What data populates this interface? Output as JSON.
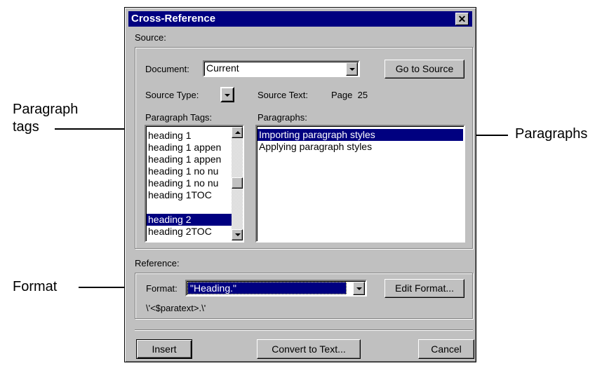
{
  "callouts": {
    "paragraph_tags": "Paragraph\ntags",
    "paragraph_tags_line1": "Paragraph",
    "paragraph_tags_line2": "tags",
    "paragraphs": "Paragraphs",
    "format": "Format"
  },
  "dialog": {
    "title": "Cross-Reference",
    "close_glyph": "✕",
    "source": {
      "group_label": "Source:",
      "document_label": "Document:",
      "document_value": "Current",
      "go_to_source_label": "Go to Source",
      "source_type_label": "Source Type:",
      "source_text_label": "Source Text:",
      "source_text_value": "Page  25",
      "paragraph_tags_label": "Paragraph Tags:",
      "paragraphs_label": "Paragraphs:",
      "paragraph_tags": [
        "heading 1",
        "heading 1 appen",
        "heading 1 appen",
        "heading 1 no nu",
        "heading 1 no nu",
        "heading 1TOC",
        "heading 2",
        "heading 2TOC"
      ],
      "paragraph_tags_selected_index": 6,
      "paragraphs": [
        "Importing paragraph styles",
        "Applying paragraph styles"
      ],
      "paragraphs_selected_index": 0
    },
    "reference": {
      "group_label": "Reference:",
      "format_label": "Format:",
      "format_value": "\"Heading.\"",
      "edit_format_label": "Edit Format...",
      "format_definition": "\\'<$paratext>.\\'"
    },
    "buttons": {
      "insert": "Insert",
      "convert": "Convert to Text...",
      "cancel": "Cancel"
    }
  },
  "colors": {
    "face": "#c0c0c0",
    "title_bar": "#000080",
    "selection": "#000080",
    "shadow": "#808080",
    "highlight": "#ffffff"
  }
}
